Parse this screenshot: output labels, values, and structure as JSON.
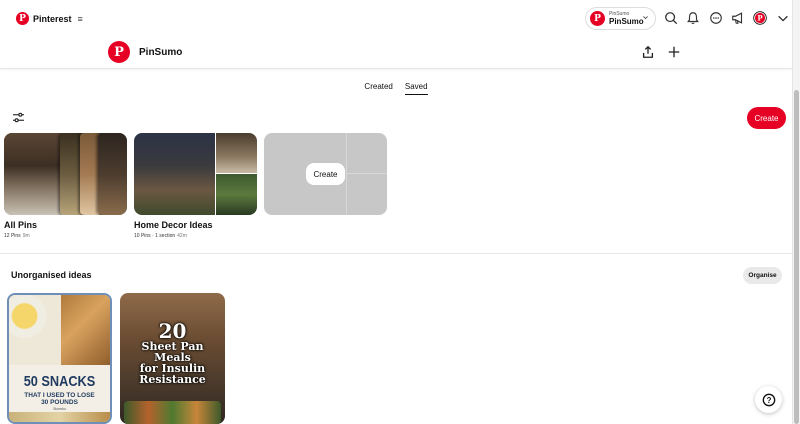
{
  "topnav": {
    "brand_name": "Pinterest",
    "logo_letter": "P",
    "menu_glyph": "≡",
    "account": {
      "sub_label": "PinSumo",
      "name": "PinSumo",
      "avatar_letter": "P"
    },
    "icons": [
      "search-icon",
      "bell-icon",
      "message-icon",
      "megaphone-icon",
      "avatar",
      "chevron-down-icon"
    ]
  },
  "profile": {
    "name": "PinSumo",
    "avatar_letter": "P"
  },
  "tabs": [
    {
      "label": "Created",
      "active": false
    },
    {
      "label": "Saved",
      "active": true
    }
  ],
  "toolbar": {
    "create_label": "Create"
  },
  "boards": [
    {
      "title": "All Pins",
      "pin_count": "12 Pins",
      "sections": "",
      "age": "9m"
    },
    {
      "title": "Home Decor Ideas",
      "pin_count": "10 Pins",
      "sections": "1 section",
      "age": "42m"
    },
    {
      "create_label": "Create"
    }
  ],
  "unorganised": {
    "title": "Unorganised ideas",
    "organise_label": "Organise",
    "pins": [
      {
        "headline": "50 SNACKS",
        "subline": "THAT I USED TO LOSE",
        "subline2": "30 POUNDS",
        "credit": "Stoneko"
      },
      {
        "number": "20",
        "line1": "Sheet Pan",
        "line2": "Meals",
        "line3": "for Insulin",
        "line4": "Resistance"
      }
    ]
  },
  "help": {
    "label": "?"
  },
  "colors": {
    "brand": "#e60023",
    "pin_text_blue": "#1e3a5f"
  }
}
